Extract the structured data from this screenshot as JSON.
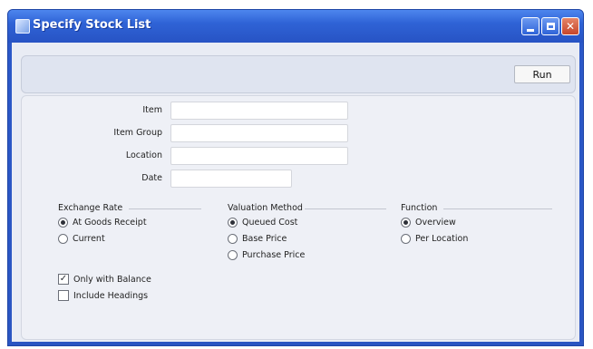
{
  "window": {
    "title": "Specify Stock List"
  },
  "toolbar": {
    "run_label": "Run"
  },
  "fields": [
    {
      "label": "Item",
      "value": ""
    },
    {
      "label": "Item Group",
      "value": ""
    },
    {
      "label": "Location",
      "value": ""
    },
    {
      "label": "Date",
      "value": ""
    }
  ],
  "exchange_rate": {
    "title": "Exchange Rate",
    "options": [
      {
        "label": "At Goods Receipt",
        "selected": true
      },
      {
        "label": "Current",
        "selected": false
      }
    ]
  },
  "valuation_method": {
    "title": "Valuation Method",
    "options": [
      {
        "label": "Queued Cost",
        "selected": true
      },
      {
        "label": "Base Price",
        "selected": false
      },
      {
        "label": "Purchase Price",
        "selected": false
      }
    ]
  },
  "function": {
    "title": "Function",
    "options": [
      {
        "label": "Overview",
        "selected": true
      },
      {
        "label": "Per Location",
        "selected": false
      }
    ]
  },
  "checkboxes": [
    {
      "label": "Only with Balance",
      "checked": true
    },
    {
      "label": "Include Headings",
      "checked": false
    }
  ],
  "icons": {
    "window": "stock-list-window-icon",
    "minimize": "minimize-icon",
    "maximize": "maximize-icon",
    "close": "close-icon"
  },
  "colors": {
    "titlebar": "#2f63d6",
    "close_button": "#c7462b",
    "client_background": "#e9ecf4"
  }
}
